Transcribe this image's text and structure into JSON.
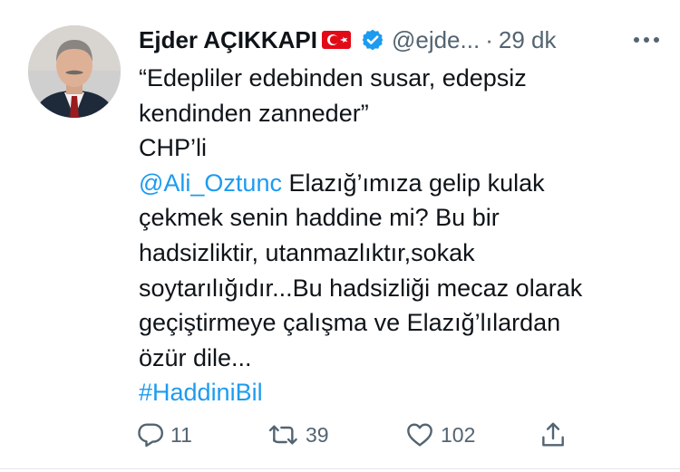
{
  "tweet": {
    "author_name": "Ejder AÇIKKAPI",
    "flag": "turkey-flag",
    "verified": true,
    "handle": "@ejde...",
    "separator": "·",
    "time": "29 dk",
    "text_lines": {
      "l1": "“Edepliler edebinden susar, edepsiz",
      "l2": "kendinden zanneder”",
      "l3": "CHP’li",
      "l4_mention": "@Ali_Oztunc",
      "l4_rest": " Elazığ’ımıza gelip kulak",
      "l5": "çekmek senin haddine mi? Bu bir",
      "l6": "hadsizliktir, utanmazlıktır,sokak",
      "l7": "soytarılığıdır...Bu hadsizliği mecaz olarak",
      "l8": "geçiştirmeye çalışma ve Elazığ’lılardan",
      "l9": "özür dile...",
      "l10_hashtag": "#HaddiniBil"
    },
    "actions": {
      "reply_count": "11",
      "retweet_count": "39",
      "like_count": "102"
    }
  },
  "colors": {
    "accent": "#1d9bf0",
    "muted": "#536471",
    "text": "#0f1419"
  }
}
